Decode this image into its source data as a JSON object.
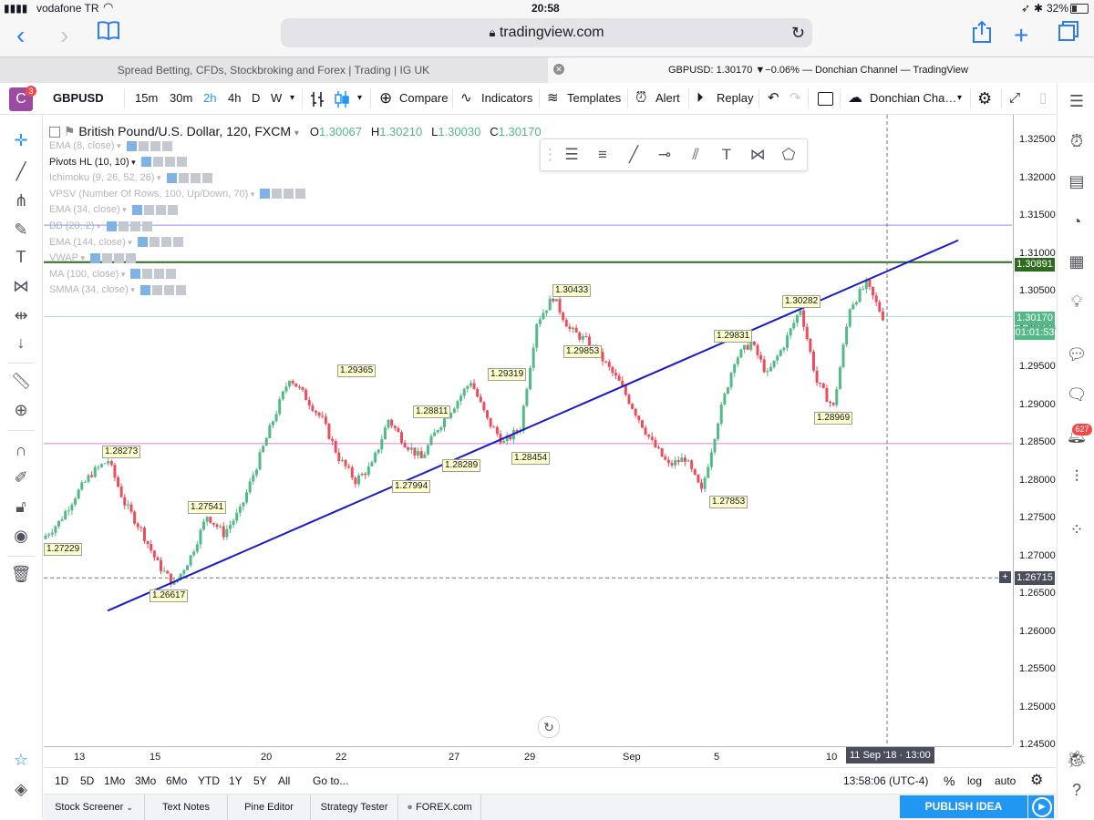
{
  "statusbar": {
    "carrier": "vodafone TR",
    "time": "20:58",
    "battery": "32%"
  },
  "browser": {
    "url": "tradingview.com",
    "tab1": "Spread Betting, CFDs, Stockbroking and Forex | Trading | IG UK",
    "tab2": "GBPUSD: 1.30170 ▼−0.06% — Donchian Channel — TradingView"
  },
  "toolbar": {
    "avatar": "C",
    "avatar_badge": "3",
    "symbol": "GBPUSD",
    "intervals": [
      "15m",
      "30m",
      "2h",
      "4h",
      "D",
      "W"
    ],
    "compare": "Compare",
    "indicators": "Indicators",
    "templates": "Templates",
    "alert": "Alert",
    "replay": "Replay",
    "layout": "Donchian Cha…"
  },
  "legend": {
    "title": "British Pound/U.S. Dollar, 120, FXCM",
    "o_label": "O",
    "o": "1.30067",
    "h_label": "H",
    "h": "1.30210",
    "l_label": "L",
    "l": "1.30030",
    "c_label": "C",
    "c": "1.30170",
    "indicators": [
      "EMA (8, close)",
      "Pivots HL (10, 10)",
      "Ichimoku (9, 26, 52, 26)",
      "VPSV (Number Of Rows, 100, Up/Down, 70)",
      "EMA (34, close)",
      "BB (20, 2)",
      "EMA (144, close)",
      "VWAP",
      "MA (100, close)",
      "SMMA (34, close)"
    ]
  },
  "price_axis": {
    "ticks": [
      "1.32500",
      "1.32000",
      "1.31500",
      "1.31000",
      "1.30500",
      "1.30000",
      "1.29500",
      "1.29000",
      "1.28500",
      "1.28000",
      "1.27500",
      "1.27000",
      "1.26500",
      "1.26000",
      "1.25500",
      "1.25000",
      "1.24500"
    ],
    "label_green": "1.30891",
    "label_last": "1.30170",
    "label_countdown": "01:01:53",
    "label_cursor": "1.26715"
  },
  "time_axis": {
    "labels": [
      "13",
      "15",
      "20",
      "22",
      "27",
      "29",
      "Sep",
      "5",
      "10"
    ],
    "cursor": "11 Sep '18 · 13:00"
  },
  "pivots": [
    "1.28273",
    "1.27229",
    "1.27541",
    "1.26617",
    "1.29365",
    "1.27994",
    "1.28811",
    "1.28289",
    "1.29319",
    "1.28454",
    "1.30433",
    "1.29853",
    "1.29831",
    "1.27853",
    "1.30282",
    "1.28969"
  ],
  "range_bar": {
    "ranges": [
      "1D",
      "5D",
      "1Mo",
      "3Mo",
      "6Mo",
      "YTD",
      "1Y",
      "5Y",
      "All"
    ],
    "goto": "Go to...",
    "clock": "13:58:06 (UTC-4)",
    "pct": "%",
    "log": "log",
    "auto": "auto"
  },
  "bottom_panel": {
    "tabs": [
      "Stock Screener",
      "Text Notes",
      "Pine Editor",
      "Strategy Tester",
      "FOREX.com"
    ],
    "publish": "PUBLISH IDEA"
  },
  "right_panel": {
    "badge": "627"
  },
  "colors": {
    "up": "#53b987",
    "down": "#eb4d5c",
    "trendline": "#1a1acc",
    "green_level": "#2e6b1e",
    "blue_axis": "#2d7cf6",
    "publish": "#2196f3"
  },
  "chart_data": {
    "type": "candlestick",
    "y_range": [
      1.245,
      1.3284
    ],
    "candles_close_approx": [
      1.2723,
      1.2745,
      1.278,
      1.281,
      1.2827,
      1.277,
      1.2735,
      1.269,
      1.2662,
      1.27,
      1.2754,
      1.273,
      1.276,
      1.282,
      1.288,
      1.2937,
      1.291,
      1.288,
      1.283,
      1.28,
      1.282,
      1.2881,
      1.285,
      1.2829,
      1.287,
      1.29,
      1.2932,
      1.288,
      1.285,
      1.287,
      1.301,
      1.3043,
      1.3,
      1.2985,
      1.296,
      1.293,
      1.289,
      1.285,
      1.282,
      1.283,
      1.2785,
      1.288,
      1.296,
      1.2983,
      1.294,
      1.298,
      1.3028,
      1.293,
      1.2897,
      1.303,
      1.306,
      1.3017
    ]
  }
}
